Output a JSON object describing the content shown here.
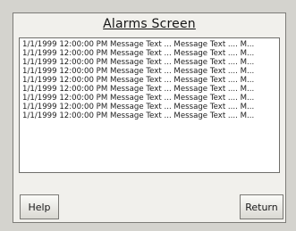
{
  "screen": {
    "title": "Alarms Screen"
  },
  "alarms": [
    {
      "text": "1/1/1999 12:00:00 PM Message Text ... Message Text .... M..."
    },
    {
      "text": "1/1/1999 12:00:00 PM Message Text ... Message Text .... M..."
    },
    {
      "text": "1/1/1999 12:00:00 PM Message Text ... Message Text .... M..."
    },
    {
      "text": "1/1/1999 12:00:00 PM Message Text ... Message Text .... M..."
    },
    {
      "text": "1/1/1999 12:00:00 PM Message Text ... Message Text .... M..."
    },
    {
      "text": "1/1/1999 12:00:00 PM Message Text ... Message Text .... M..."
    },
    {
      "text": "1/1/1999 12:00:00 PM Message Text ... Message Text .... M..."
    },
    {
      "text": "1/1/1999 12:00:00 PM Message Text ... Message Text .... M..."
    },
    {
      "text": "1/1/1999 12:00:00 PM Message Text ... Message Text .... M..."
    }
  ],
  "buttons": {
    "help_label": "Help",
    "return_label": "Return"
  }
}
